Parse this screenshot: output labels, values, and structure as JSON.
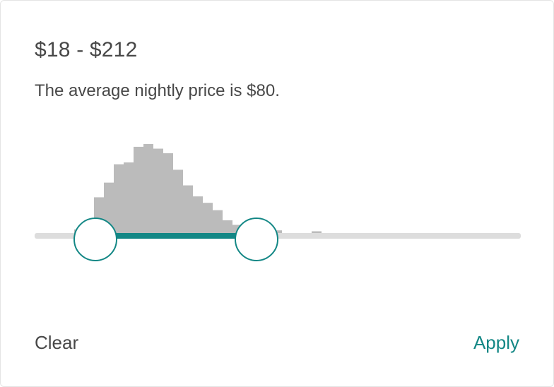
{
  "filter": {
    "price_range_label": "$18 - $212",
    "average_text": "The average nightly price is $80."
  },
  "slider": {
    "min_value": 18,
    "max_value": 212,
    "selected_low_fraction": 0.0,
    "selected_high_fraction": 0.33,
    "colors": {
      "accent": "#138785",
      "track": "#dddddd",
      "histogram": "#bbbbbb",
      "handle_fill": "#ffffff"
    },
    "histogram_levels": [
      0.03,
      0.07,
      0.14,
      0.42,
      0.58,
      0.78,
      0.8,
      0.97,
      1.0,
      0.95,
      0.9,
      0.72,
      0.55,
      0.43,
      0.36,
      0.28,
      0.17,
      0.12,
      0.1,
      0.09,
      0.08,
      0.06,
      0.02,
      0.02,
      0.03,
      0.05,
      0.01,
      0.01,
      0.01,
      0.01,
      0.01
    ]
  },
  "actions": {
    "clear_label": "Clear",
    "apply_label": "Apply"
  }
}
